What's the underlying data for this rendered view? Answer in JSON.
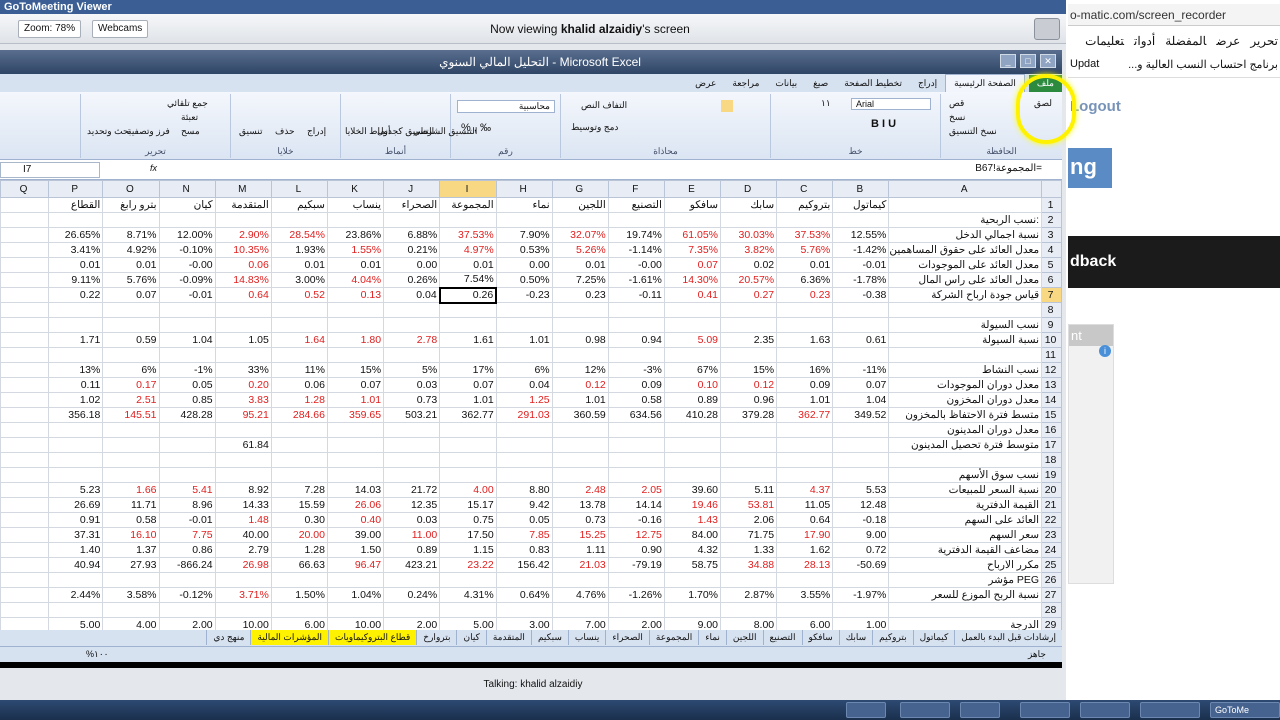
{
  "viewer": {
    "title": "GoToMeeting Viewer",
    "zoom": "Zoom: 78%",
    "webcams": "Webcams",
    "viewing_prefix": "Now viewing ",
    "viewing_name": "khalid alzaidiy",
    "viewing_suffix": "'s screen",
    "talking": "Talking: khalid alzaidiy"
  },
  "excel": {
    "title": "التحليل المالي السنوي - Microsoft Excel",
    "namebox": "I7",
    "formula": "=المجموعة!B67",
    "tabs": [
      "ملف",
      "الصفحة الرئيسية",
      "إدراج",
      "تخطيط الصفحة",
      "صيغ",
      "بيانات",
      "مراجعة",
      "عرض"
    ],
    "groups": [
      "الحافظة",
      "خط",
      "محاذاة",
      "رقم",
      "أنماط",
      "خلايا",
      "تحرير"
    ],
    "ribbon": {
      "paste": "لصق",
      "cut": "قص",
      "copy": "نسخ",
      "format_painter": "نسخ التنسيق",
      "font": "Arial",
      "size": "١١",
      "wrap": "التفاف النص",
      "merge": "دمج وتوسيط",
      "number_format": "محاسبية",
      "cond": "التنسيق الشرطي",
      "table": "التنسيق كجدول",
      "styles": "أنماط الخلايا",
      "insert": "إدراج",
      "delete": "حذف",
      "format": "تنسيق",
      "autosum": "جمع تلقائي",
      "fill": "تعبئة",
      "clear": "مسح",
      "sort": "فرز وتصفية",
      "find": "بحث وتحديد"
    },
    "columns": [
      "A",
      "B",
      "C",
      "D",
      "E",
      "F",
      "G",
      "H",
      "I",
      "J",
      "K",
      "L",
      "M",
      "N",
      "O",
      "P",
      "Q"
    ],
    "status_ready": "جاهز",
    "zoom": "%١٠٠",
    "sheets": [
      "إرشادات قبل البدء بالعمل",
      "كيماتول",
      "بتروكيم",
      "سابك",
      "سافكو",
      "التصنيع",
      "اللجين",
      "نماء",
      "المجموعة",
      "الصحراء",
      "ينساب",
      "سبكيم",
      "المتقدمة",
      "كيان",
      "بتروارخ",
      "قطاع البتروكيماويات",
      "المؤشرات المالية",
      "منهج دي"
    ]
  },
  "rows": [
    {
      "n": "1",
      "a": "",
      "v": [
        "كيماتول",
        "بتروكيم",
        "سابك",
        "سافكو",
        "التصنيع",
        "اللجين",
        "نماء",
        "المجموعة",
        "الصحراء",
        "ينساب",
        "سبكيم",
        "المتقدمة",
        "كيان",
        "بترو رابغ",
        "القطاع",
        ""
      ]
    },
    {
      "n": "2",
      "a": "نسب الربحية:",
      "v": []
    },
    {
      "n": "3",
      "a": "نسبة اجمالي الدخل",
      "v": [
        "12.55%",
        "37.53%",
        "30.03%",
        "61.05%",
        "19.74%",
        "32.07%",
        "7.90%",
        "37.53%",
        "6.88%",
        "23.86%",
        "28.54%",
        "2.90%",
        "12.00%",
        "8.71%",
        "26.65%",
        ""
      ]
    },
    {
      "n": "4",
      "a": "معدل العائد على حقوق المساهمين",
      "v": [
        "-1.42%",
        "5.76%",
        "3.82%",
        "7.35%",
        "-1.14%",
        "5.26%",
        "0.53%",
        "4.97%",
        "0.21%",
        "1.55%",
        "1.93%",
        "10.35%",
        "-0.10%",
        "4.92%",
        "3.41%",
        ""
      ]
    },
    {
      "n": "5",
      "a": "معدل العائد على الموجودات",
      "v": [
        "-0.01",
        "0.01",
        "0.02",
        "0.07",
        "-0.00",
        "0.01",
        "0.00",
        "0.01",
        "0.00",
        "0.01",
        "0.01",
        "0.06",
        "-0.00",
        "0.01",
        "0.01",
        ""
      ]
    },
    {
      "n": "6",
      "a": "معدل العائد على راس المال",
      "v": [
        "-1.78%",
        "6.36%",
        "20.57%",
        "14.30%",
        "-1.61%",
        "7.25%",
        "0.50%",
        "7.54%",
        "0.26%",
        "4.04%",
        "3.00%",
        "14.83%",
        "-0.09%",
        "5.76%",
        "9.11%",
        ""
      ]
    },
    {
      "n": "7",
      "a": "قياس جودة ارباح الشركة",
      "v": [
        "-0.38",
        "0.23",
        "0.27",
        "0.41",
        "-0.11",
        "0.23",
        "-0.23",
        "0.26",
        "0.04",
        "0.13",
        "0.52",
        "0.64",
        "-0.01",
        "0.07",
        "0.22",
        ""
      ]
    },
    {
      "n": "8",
      "a": "",
      "v": []
    },
    {
      "n": "9",
      "a": "نسب السيولة",
      "v": []
    },
    {
      "n": "10",
      "a": "نسبة السيولة",
      "v": [
        "0.61",
        "1.63",
        "2.35",
        "5.09",
        "0.94",
        "0.98",
        "1.01",
        "1.61",
        "2.78",
        "1.80",
        "1.64",
        "1.05",
        "1.04",
        "0.59",
        "1.71",
        ""
      ]
    },
    {
      "n": "11",
      "a": "",
      "v": []
    },
    {
      "n": "12",
      "a": "نسب النشاط",
      "v": [
        "-11%",
        "16%",
        "15%",
        "67%",
        "-3%",
        "12%",
        "6%",
        "17%",
        "5%",
        "15%",
        "11%",
        "33%",
        "-1%",
        "6%",
        "13%",
        ""
      ]
    },
    {
      "n": "13",
      "a": "معدل دوران الموجودات",
      "v": [
        "0.07",
        "0.09",
        "0.12",
        "0.10",
        "0.09",
        "0.12",
        "0.04",
        "0.07",
        "0.03",
        "0.07",
        "0.06",
        "0.20",
        "0.05",
        "0.17",
        "0.11",
        ""
      ]
    },
    {
      "n": "14",
      "a": "معدل دوران المخزون",
      "v": [
        "1.04",
        "1.01",
        "0.96",
        "0.89",
        "0.58",
        "1.01",
        "1.25",
        "1.01",
        "0.73",
        "1.01",
        "1.28",
        "3.83",
        "0.85",
        "2.51",
        "1.02",
        ""
      ]
    },
    {
      "n": "15",
      "a": "متسط فترة الاحتفاظ بالمخزون",
      "v": [
        "349.52",
        "362.77",
        "379.28",
        "410.28",
        "634.56",
        "360.59",
        "291.03",
        "362.77",
        "503.21",
        "359.65",
        "284.66",
        "95.21",
        "428.28",
        "145.51",
        "356.18",
        ""
      ]
    },
    {
      "n": "16",
      "a": "معدل دوران المدينون",
      "v": []
    },
    {
      "n": "17",
      "a": "متوسط فترة تحصيل المدينون",
      "v": [
        "",
        "",
        "",
        "",
        "",
        "",
        "",
        "",
        "",
        "",
        "",
        "61.84",
        "",
        "",
        "",
        ""
      ]
    },
    {
      "n": "18",
      "a": "",
      "v": []
    },
    {
      "n": "19",
      "a": "نسب سوق الأسهم",
      "v": []
    },
    {
      "n": "20",
      "a": "نسبة السعر للمبيعات",
      "v": [
        "5.53",
        "4.37",
        "5.11",
        "39.60",
        "2.05",
        "2.48",
        "8.80",
        "4.00",
        "21.72",
        "14.03",
        "7.28",
        "8.92",
        "5.41",
        "1.66",
        "5.23",
        ""
      ]
    },
    {
      "n": "21",
      "a": "القيمة الدفترية",
      "v": [
        "12.48",
        "11.05",
        "53.81",
        "19.46",
        "14.14",
        "13.78",
        "9.42",
        "15.17",
        "12.35",
        "26.06",
        "15.59",
        "14.33",
        "8.96",
        "11.71",
        "26.69",
        ""
      ]
    },
    {
      "n": "22",
      "a": "العائد على السهم",
      "v": [
        "-0.18",
        "0.64",
        "2.06",
        "1.43",
        "-0.16",
        "0.73",
        "0.05",
        "0.75",
        "0.03",
        "0.40",
        "0.30",
        "1.48",
        "-0.01",
        "0.58",
        "0.91",
        ""
      ]
    },
    {
      "n": "23",
      "a": "سعر السهم",
      "v": [
        "9.00",
        "17.90",
        "71.75",
        "84.00",
        "12.75",
        "15.25",
        "7.85",
        "17.50",
        "11.00",
        "39.00",
        "20.00",
        "40.00",
        "7.75",
        "16.10",
        "37.31",
        ""
      ]
    },
    {
      "n": "24",
      "a": "مضاعف القيمة الدفترية",
      "v": [
        "0.72",
        "1.62",
        "1.33",
        "4.32",
        "0.90",
        "1.11",
        "0.83",
        "1.15",
        "0.89",
        "1.50",
        "1.28",
        "2.79",
        "0.86",
        "1.37",
        "1.40",
        ""
      ]
    },
    {
      "n": "25",
      "a": "مكرر الارباح",
      "v": [
        "-50.69",
        "28.13",
        "34.88",
        "58.75",
        "-79.19",
        "21.03",
        "156.42",
        "23.22",
        "423.21",
        "96.47",
        "66.63",
        "26.98",
        "-866.24",
        "27.93",
        "40.94",
        ""
      ]
    },
    {
      "n": "26",
      "a": "مؤشر PEG",
      "v": []
    },
    {
      "n": "27",
      "a": "نسبة الربح الموزع للسعر",
      "v": [
        "-1.97%",
        "3.55%",
        "2.87%",
        "1.70%",
        "-1.26%",
        "4.76%",
        "0.64%",
        "4.31%",
        "0.24%",
        "1.04%",
        "1.50%",
        "3.71%",
        "-0.12%",
        "3.58%",
        "2.44%",
        ""
      ]
    },
    {
      "n": "28",
      "a": "",
      "v": []
    },
    {
      "n": "29",
      "a": "الدرجة",
      "v": [
        "1.00",
        "6.00",
        "8.00",
        "9.00",
        "2.00",
        "7.00",
        "3.00",
        "5.00",
        "2.00",
        "10.00",
        "6.00",
        "10.00",
        "2.00",
        "4.00",
        "5.00",
        ""
      ]
    }
  ],
  "red_cells": {
    "3": [
      1,
      2,
      3,
      5,
      7,
      10,
      11
    ],
    "4": [
      1,
      2,
      3,
      5,
      7,
      9,
      11
    ],
    "5": [
      3,
      11
    ],
    "6": [
      2,
      3,
      9,
      11
    ],
    "7": [
      1,
      2,
      3,
      9,
      10,
      11
    ],
    "10": [
      3,
      8,
      9,
      10
    ],
    "13": [
      2,
      3,
      5,
      11,
      13
    ],
    "14": [
      6,
      9,
      10,
      11,
      13
    ],
    "15": [
      1,
      6,
      9,
      10,
      11,
      13
    ],
    "20": [
      1,
      4,
      5,
      7,
      12,
      13
    ],
    "21": [
      2,
      3,
      9
    ],
    "22": [
      3,
      9,
      11
    ],
    "23": [
      1,
      4,
      5,
      6,
      8,
      10,
      12,
      13
    ],
    "25": [
      1,
      2,
      5,
      7,
      9,
      11
    ],
    "27": [
      11
    ]
  },
  "browser": {
    "url": "o-matic.com/screen_recorder",
    "menu": [
      "تحرير",
      "عرض",
      "المفضلة",
      "أدوات",
      "تعليمات"
    ],
    "bookmark": "برنامج احتساب النسب العالية و...",
    "bookmark2": "Updat",
    "logout": "Logout",
    "brand": "ng",
    "feedback": "dback",
    "panel": "nt"
  },
  "taskbar": {
    "gotomeeting": "GoToMe"
  }
}
